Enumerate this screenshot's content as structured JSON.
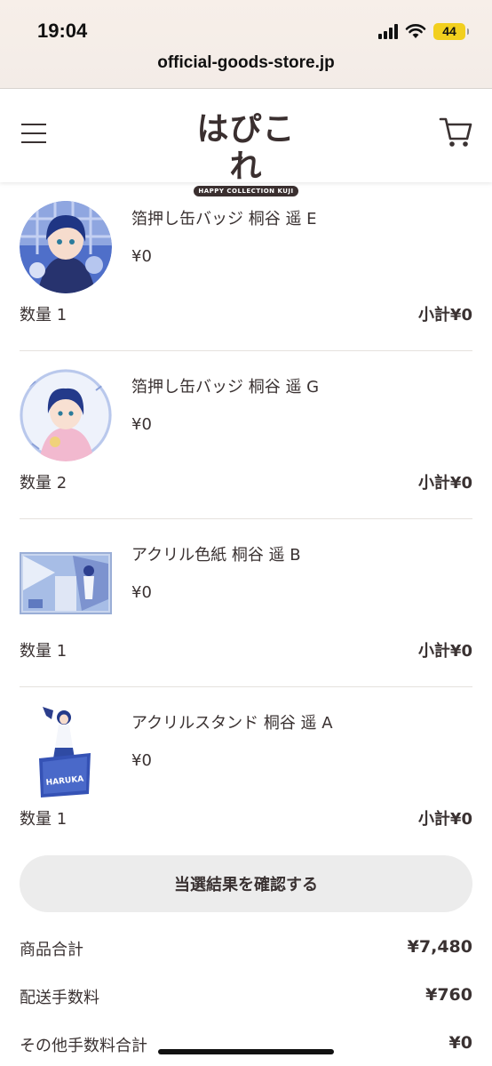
{
  "status_bar": {
    "time": "19:04",
    "battery": "44",
    "url": "official-goods-store.jp"
  },
  "header": {
    "logo_title": "はぴこれ",
    "logo_subtitle": "HAPPY COLLECTION KUJI"
  },
  "items": [
    {
      "name": "箔押し缶バッジ 桐谷 遥 E",
      "price": "¥0",
      "quantity": "数量 1",
      "subtotal": "小計¥0"
    },
    {
      "name": "箔押し缶バッジ 桐谷 遥 G",
      "price": "¥0",
      "quantity": "数量 2",
      "subtotal": "小計¥0"
    },
    {
      "name": "アクリル色紙 桐谷 遥 B",
      "price": "¥0",
      "quantity": "数量 1",
      "subtotal": "小計¥0"
    },
    {
      "name": "アクリルスタンド 桐谷 遥 A",
      "price": "¥0",
      "quantity": "数量 1",
      "subtotal": "小計¥0",
      "stand_text": "HARUKA"
    }
  ],
  "confirm_button": "当選結果を確認する",
  "summary": [
    {
      "label": "商品合計",
      "value": "¥7,480"
    },
    {
      "label": "配送手数料",
      "value": "¥760"
    },
    {
      "label": "その他手数料合計",
      "value": "¥0"
    }
  ],
  "colors": {
    "text": "#3a3232",
    "button_bg": "#ececec",
    "battery": "#f2cf1e"
  }
}
